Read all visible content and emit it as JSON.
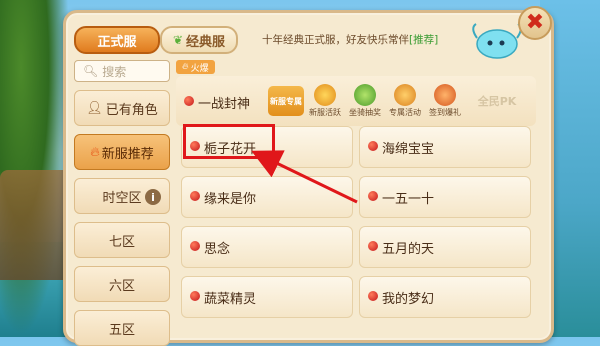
{
  "tabs": {
    "official": "正式服",
    "classic": "经典服"
  },
  "notice": {
    "text": "十年经典正式服，好友快乐常伴",
    "tag": "[推荐]"
  },
  "search": {
    "placeholder": "搜索"
  },
  "sidebar": [
    {
      "label": "已有角色",
      "icon": "person-icon",
      "active": false
    },
    {
      "label": "新服推荐",
      "icon": "fire-icon",
      "active": true
    },
    {
      "label": "时空区",
      "info": "i",
      "active": false
    },
    {
      "label": "七区",
      "active": false
    },
    {
      "label": "六区",
      "active": false
    },
    {
      "label": "五区",
      "active": false
    }
  ],
  "hot_label": "火爆",
  "featured": {
    "name": "一战封神",
    "badge": "新服专属",
    "activities": [
      "新服活跃",
      "坐骑抽奖",
      "专属活动",
      "签到爆礼"
    ],
    "pk": "全民PK"
  },
  "servers": [
    {
      "name": "栀子花开",
      "highlighted": true
    },
    {
      "name": "海绵宝宝"
    },
    {
      "name": "缘来是你"
    },
    {
      "name": "一五一十"
    },
    {
      "name": "思念"
    },
    {
      "name": "五月的天"
    },
    {
      "name": "蔬菜精灵"
    },
    {
      "name": "我的梦幻"
    }
  ],
  "colors": {
    "highlight": "#e0171a",
    "accent": "#e07b1e"
  }
}
